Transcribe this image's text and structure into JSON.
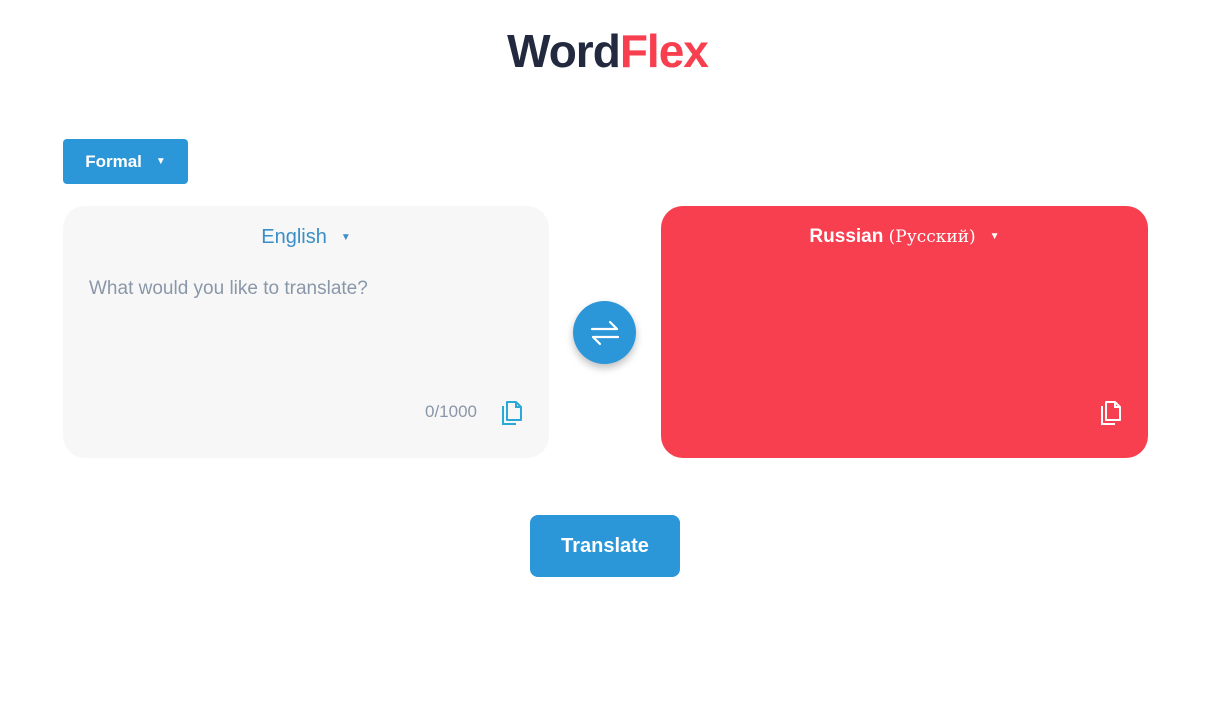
{
  "logo": {
    "part1": "Word",
    "part2": "Flex",
    "color_dark": "#232a3f",
    "color_accent": "#f83f4f"
  },
  "tone": {
    "selected": "Formal"
  },
  "source": {
    "language": "English",
    "placeholder": "What would you like to translate?",
    "value": "",
    "counter": "0/1000"
  },
  "target": {
    "language": "Russian",
    "language_native": "(Русский)",
    "output": ""
  },
  "actions": {
    "translate_label": "Translate"
  },
  "icons": {
    "swap": "swap-arrows-icon",
    "copy": "copy-icon",
    "caret": "caret-down-icon"
  },
  "colors": {
    "primary": "#2b96d8",
    "accent": "#f83f4f",
    "panel_bg": "#f7f7f7"
  }
}
